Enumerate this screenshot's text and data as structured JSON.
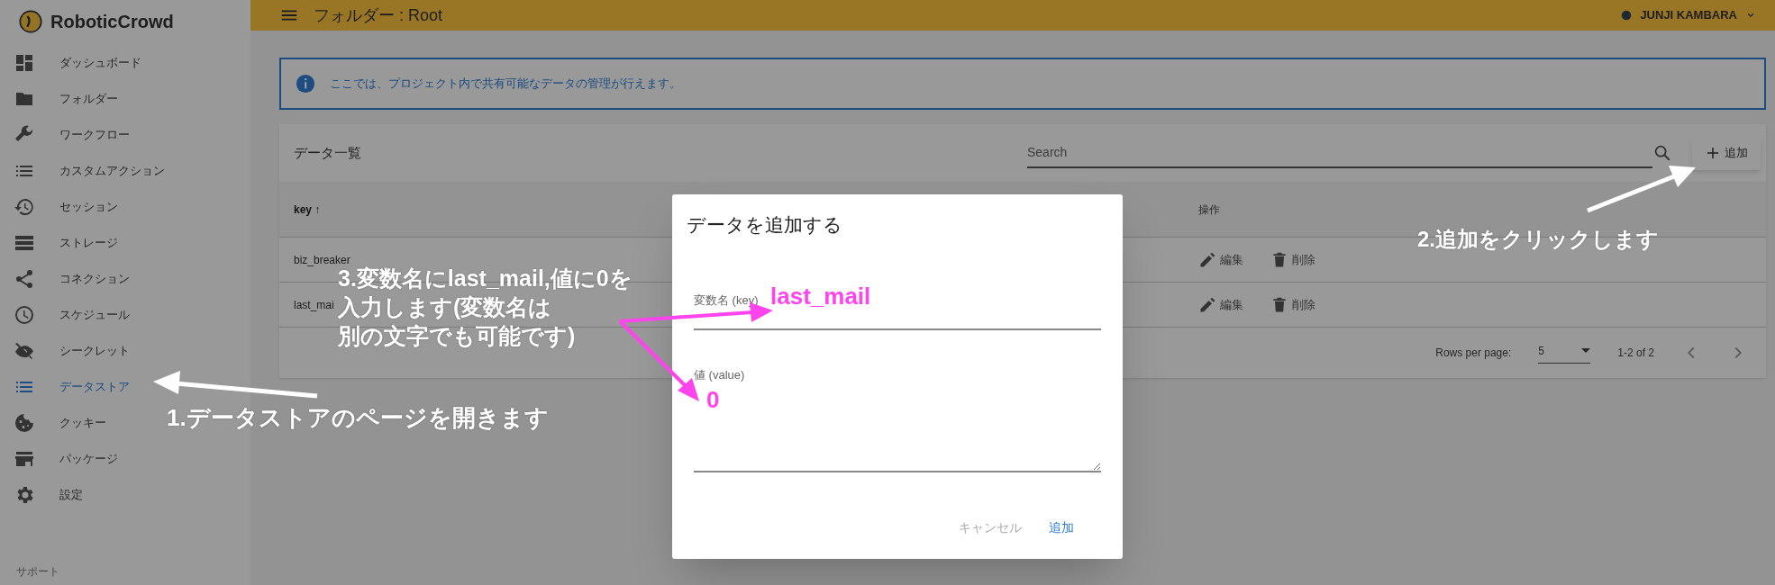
{
  "app": {
    "logo": "RoboticCrowd",
    "header_title": "フォルダー : Root",
    "user": "JUNJI KAMBARA"
  },
  "sidebar": {
    "items": [
      {
        "label": "ダッシュボード",
        "selected": false
      },
      {
        "label": "フォルダー",
        "selected": false
      },
      {
        "label": "ワークフロー",
        "selected": false
      },
      {
        "label": "カスタムアクション",
        "selected": false
      },
      {
        "label": "セッション",
        "selected": false
      },
      {
        "label": "ストレージ",
        "selected": false
      },
      {
        "label": "コネクション",
        "selected": false
      },
      {
        "label": "スケジュール",
        "selected": false
      },
      {
        "label": "シークレット",
        "selected": false
      },
      {
        "label": "データストア",
        "selected": true
      },
      {
        "label": "クッキー",
        "selected": false
      },
      {
        "label": "パッケージ",
        "selected": false
      },
      {
        "label": "設定",
        "selected": false
      }
    ],
    "section": "サポート"
  },
  "info": "ここでは、プロジェクト内で共有可能なデータの管理が行えます。",
  "card": {
    "title": "データ一覧",
    "search": {
      "placeholder": "Search"
    },
    "add_button": "追加",
    "columns": [
      "key ↑",
      "操作"
    ],
    "rows": [
      {
        "key": "biz_breaker",
        "edit": "編集",
        "delete": "削除"
      },
      {
        "key": "last_mai",
        "edit": "編集",
        "delete": "削除"
      }
    ],
    "pagination": {
      "rows_label": "Rows per page:",
      "rows_value": "5",
      "range": "1-2 of 2"
    }
  },
  "dialog": {
    "title": "データを追加する",
    "fields": [
      {
        "label": "変数名 (key)",
        "kind": "line"
      },
      {
        "label": "値 (value)",
        "kind": "textarea"
      }
    ],
    "buttons": [
      {
        "label": "キャンセル",
        "disabled": true
      },
      {
        "label": "追加",
        "disabled": false
      }
    ]
  },
  "annotations": {
    "step1": "1.データストアのページを開きます",
    "step2": "2.追加をクリックします",
    "step3": [
      "3.変数名にlast_mail,値に0を",
      "入力します(変数名は",
      "別の文字でも可能です)"
    ],
    "key_example": "last_mail",
    "value_example": "0"
  }
}
